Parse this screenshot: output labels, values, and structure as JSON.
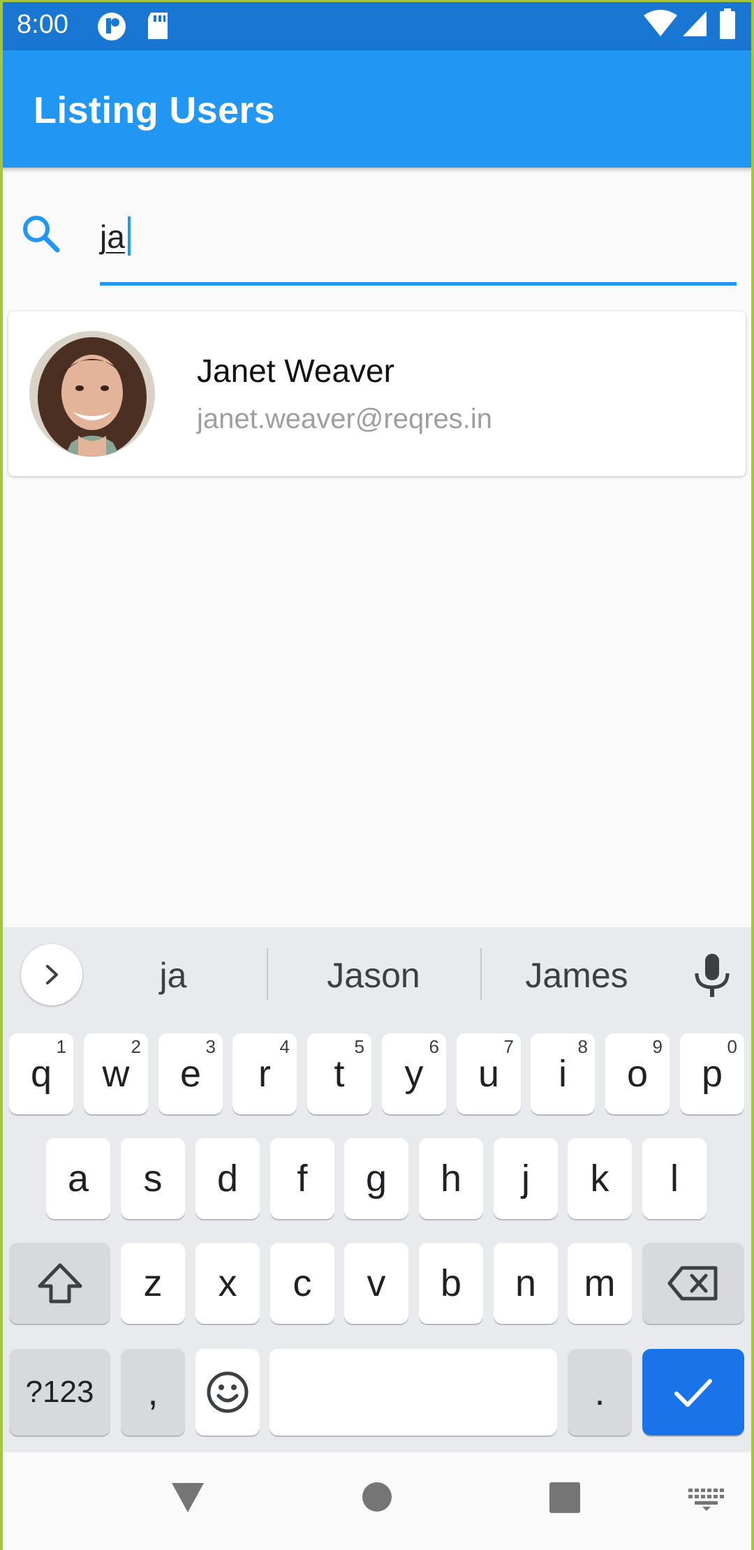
{
  "status_bar": {
    "time": "8:00",
    "icons": [
      "notification-icon",
      "sd-card-icon",
      "wifi-icon",
      "signal-icon",
      "battery-icon"
    ]
  },
  "app_bar": {
    "title": "Listing Users",
    "color": "#2196f3"
  },
  "search": {
    "value": "ja",
    "icon": "search-icon"
  },
  "users": [
    {
      "name": "Janet Weaver",
      "email": "janet.weaver@reqres.in"
    }
  ],
  "keyboard": {
    "suggestions": [
      "ja",
      "Jason",
      "James"
    ],
    "row1": [
      {
        "key": "q",
        "hint": "1"
      },
      {
        "key": "w",
        "hint": "2"
      },
      {
        "key": "e",
        "hint": "3"
      },
      {
        "key": "r",
        "hint": "4"
      },
      {
        "key": "t",
        "hint": "5"
      },
      {
        "key": "y",
        "hint": "6"
      },
      {
        "key": "u",
        "hint": "7"
      },
      {
        "key": "i",
        "hint": "8"
      },
      {
        "key": "o",
        "hint": "9"
      },
      {
        "key": "p",
        "hint": "0"
      }
    ],
    "row2": [
      "a",
      "s",
      "d",
      "f",
      "g",
      "h",
      "j",
      "k",
      "l"
    ],
    "row3": [
      "z",
      "x",
      "c",
      "v",
      "b",
      "n",
      "m"
    ],
    "symbols_label": "?123",
    "comma": ",",
    "period": ".",
    "accent_color": "#1a73e8"
  },
  "nav_bar": {
    "icons": [
      "back-icon",
      "home-icon",
      "recents-icon",
      "keyboard-switch-icon"
    ]
  }
}
